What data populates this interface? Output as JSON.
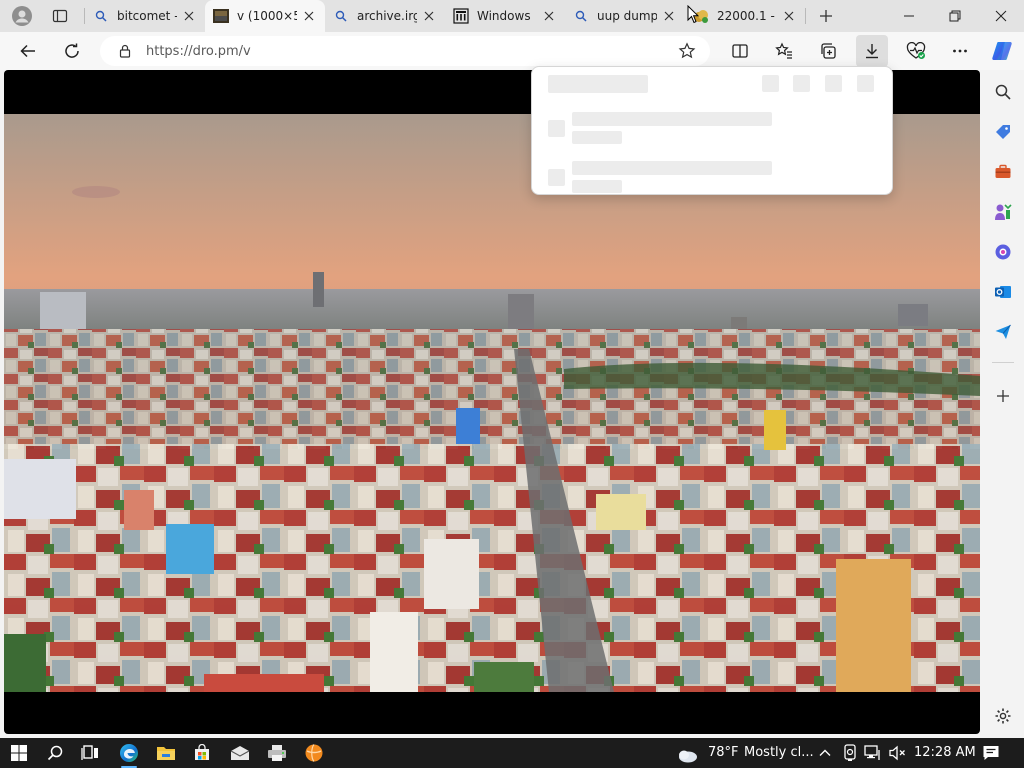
{
  "browser": {
    "tabs": [
      {
        "title": "bitcomet - ",
        "icon": "search-icon",
        "active": false
      },
      {
        "title": "v (1000×5",
        "icon": "image-icon",
        "active": true
      },
      {
        "title": "archive.irg",
        "icon": "search-icon",
        "active": false
      },
      {
        "title": "Windows",
        "icon": "archive-icon",
        "active": false
      },
      {
        "title": "uup dump",
        "icon": "search-icon",
        "active": false
      },
      {
        "title": "22000.1 - ",
        "icon": "coin-icon",
        "active": false
      }
    ],
    "address": {
      "url": "https://dro.pm/v"
    }
  },
  "downloads_flyout": {
    "state": "loading"
  },
  "taskbar": {
    "weather_temp": "78°F",
    "weather_text": "Mostly cl...",
    "clock": "12:28 AM"
  },
  "colors": {
    "tabstrip": "#e3e3e3",
    "active_tab": "#f7f7f7",
    "taskbar": "#1c1c1c",
    "accent": "#0067c0"
  }
}
